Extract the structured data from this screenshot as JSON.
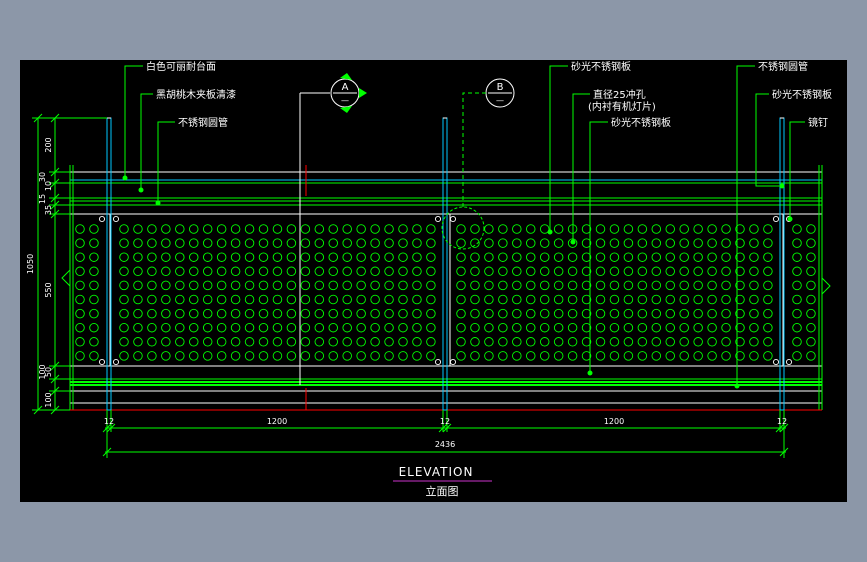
{
  "colors": {
    "background": "#000000",
    "frame": "#8c97a8",
    "green": "#00ff00",
    "white": "#ffffff",
    "cyan": "#00c8ff",
    "red": "#ff0000",
    "magenta": "#cc33cc"
  },
  "annotations": {
    "white_countertop": "白色可丽耐台面",
    "walnut_veneer": "黑胡桃木夹板清漆",
    "ss_tube_left": "不锈钢圆管",
    "brushed_ss_top": "砂光不锈钢板",
    "hole_line1": "直径25冲孔",
    "hole_line2": "(内衬有机灯片)",
    "brushed_ss_mid": "砂光不锈钢板",
    "ss_tube_right": "不锈钢圆管",
    "brushed_ss_right": "砂光不锈钢板",
    "mirror_nail": "镜钉"
  },
  "section_markers": {
    "a": {
      "letter": "A",
      "sub": "—"
    },
    "b": {
      "letter": "B",
      "sub": "—"
    }
  },
  "dimensions": {
    "left_1050": "1050",
    "left_200": "200",
    "left_15": "15",
    "left_30": "30",
    "left_10": "10",
    "left_35": "35",
    "left_550": "550",
    "left_50": "50",
    "left_100a": "100",
    "left_100b": "100",
    "bottom_12a": "12",
    "bottom_12b": "12",
    "bottom_12c": "12",
    "bottom_1200a": "1200",
    "bottom_1200b": "1200",
    "bottom_total": "2436"
  },
  "title": {
    "en": "ELEVATION",
    "zh": "立面图"
  }
}
